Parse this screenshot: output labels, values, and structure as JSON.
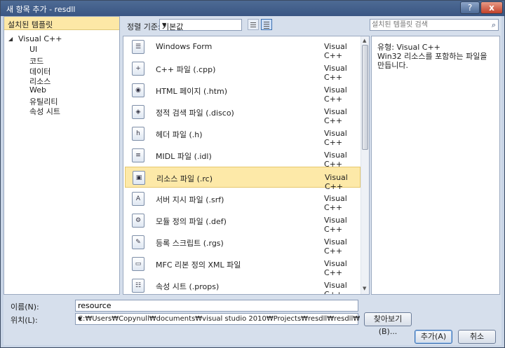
{
  "window": {
    "title": "새 항목 추가 - resdll",
    "help_label": "?",
    "close_label": "x"
  },
  "left_pane": {
    "header": "설치된 템플릿",
    "root": "Visual C++",
    "children": [
      "UI",
      "코드",
      "데이터",
      "리소스",
      "Web",
      "유틸리티",
      "속성 시트"
    ]
  },
  "toolbar": {
    "sort_label": "정렬 기준:",
    "sort_value": "기본값"
  },
  "search": {
    "placeholder": "설치된 템플릿 검색"
  },
  "templates": [
    {
      "name": "Windows Form",
      "category": "Visual C++",
      "icon": "form-icon"
    },
    {
      "name": "C++ 파일 (.cpp)",
      "category": "Visual C++",
      "icon": "cpp-file-icon"
    },
    {
      "name": "HTML 페이지 (.htm)",
      "category": "Visual C++",
      "icon": "html-file-icon"
    },
    {
      "name": "정적 검색 파일 (.disco)",
      "category": "Visual C++",
      "icon": "disco-file-icon"
    },
    {
      "name": "헤더 파일 (.h)",
      "category": "Visual C++",
      "icon": "header-file-icon"
    },
    {
      "name": "MIDL 파일 (.idl)",
      "category": "Visual C++",
      "icon": "idl-file-icon"
    },
    {
      "name": "리소스 파일 (.rc)",
      "category": "Visual C++",
      "icon": "resource-file-icon",
      "selected": true
    },
    {
      "name": "서버 지시 파일 (.srf)",
      "category": "Visual C++",
      "icon": "atl-file-icon"
    },
    {
      "name": "모듈 정의 파일 (.def)",
      "category": "Visual C++",
      "icon": "def-file-icon"
    },
    {
      "name": "등록 스크립트 (.rgs)",
      "category": "Visual C++",
      "icon": "script-file-icon"
    },
    {
      "name": "MFC 리본 정의 XML 파일",
      "category": "Visual C++",
      "icon": "ribbon-xml-icon"
    },
    {
      "name": "속성 시트 (.props)",
      "category": "Visual C++",
      "icon": "property-sheet-icon"
    }
  ],
  "info": {
    "type_label": "유형:  Visual C++",
    "description": "Win32 리소스를 포함하는 파일을 만듭니다."
  },
  "form": {
    "name_label": "이름(N):",
    "name_value": "resource",
    "location_label": "위치(L):",
    "location_value": "C:₩Users₩Copynull₩documents₩visual studio 2010₩Projects₩resdll₩resdll₩",
    "browse_label": "찾아보기(B)...",
    "add_label": "추가(A)",
    "cancel_label": "취소"
  }
}
